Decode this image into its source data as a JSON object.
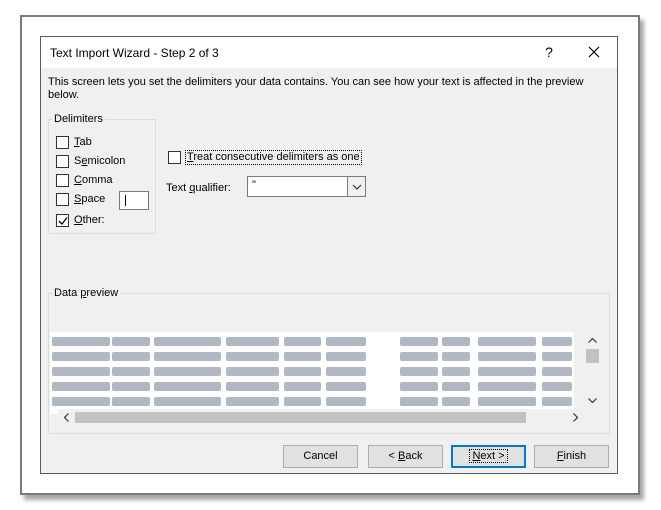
{
  "dialog": {
    "title": "Text Import Wizard - Step 2 of 3",
    "help_label": "?",
    "description": "This screen lets you set the delimiters your data contains.  You can see how your text is affected in the preview below."
  },
  "delimiters": {
    "legend": "Delimiters",
    "tab": {
      "pre": "",
      "key": "T",
      "post": "ab",
      "checked": false
    },
    "semicolon": {
      "pre": "S",
      "key": "e",
      "post": "micolon",
      "checked": false
    },
    "comma": {
      "pre": "",
      "key": "C",
      "post": "omma",
      "checked": false
    },
    "space": {
      "pre": "",
      "key": "S",
      "post": "pace",
      "checked": false
    },
    "other": {
      "pre": "",
      "key": "O",
      "post": "ther:",
      "checked": true,
      "value": ""
    }
  },
  "consecutive": {
    "pre": "",
    "key": "T",
    "post": "reat consecutive delimiters as one",
    "checked": false
  },
  "text_qualifier": {
    "label_pre": "Text ",
    "label_key": "q",
    "label_post": "ualifier:",
    "value": "\""
  },
  "preview": {
    "legend_pre": "Data ",
    "legend_key": "p",
    "legend_post": "review"
  },
  "buttons": {
    "cancel": "Cancel",
    "back": {
      "pre": "< ",
      "key": "B",
      "post": "ack"
    },
    "next": {
      "pre": "",
      "key": "N",
      "post": "ext >"
    },
    "finish": {
      "pre": "",
      "key": "F",
      "post": "inish"
    }
  },
  "colors": {
    "accent": "#0078d7",
    "dialog_bg": "#f0f0f0",
    "blurred_text": "#b0b8c4"
  }
}
